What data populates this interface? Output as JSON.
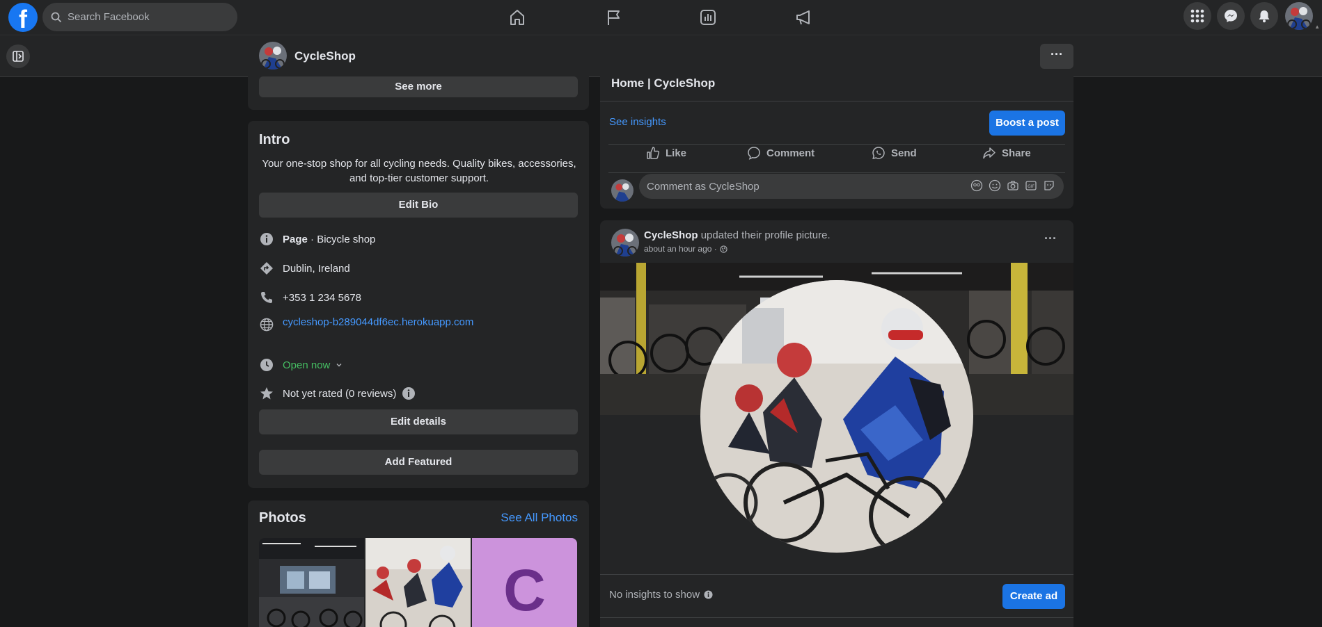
{
  "topnav": {
    "search_placeholder": "Search Facebook"
  },
  "pagebar": {
    "page_name": "CycleShop",
    "more_label": "···"
  },
  "left": {
    "see_more": "See more",
    "intro": {
      "title": "Intro",
      "bio": "Your one-stop shop for all cycling needs. Quality bikes, accessories, and top-tier customer support.",
      "edit_bio": "Edit Bio",
      "page_label": "Page",
      "page_category": " · Bicycle shop",
      "location": "Dublin, Ireland",
      "phone": "+353 1 234 5678",
      "website": "cycleshop-b289044df6ec.herokuapp.com",
      "hours": "Open now",
      "rating": "Not yet rated (0 reviews)",
      "edit_details": "Edit details",
      "add_featured": "Add Featured"
    },
    "photos": {
      "title": "Photos",
      "see_all": "See All Photos",
      "letter_tile": "C"
    }
  },
  "right": {
    "home_title": "Home | CycleShop",
    "see_insights": "See insights",
    "boost": "Boost a post",
    "actions": [
      "Like",
      "Comment",
      "Send",
      "Share"
    ],
    "comment_placeholder": "Comment as CycleShop",
    "post": {
      "author": "CycleShop",
      "text": " updated their profile picture.",
      "time": "about an hour ago ·",
      "more": "···",
      "no_insights": "No insights to show",
      "create_ad": "Create ad"
    }
  },
  "colors": {
    "background": "#18191a",
    "surface": "#242526",
    "button": "#3a3b3c",
    "accent": "#1b74e4",
    "link": "#4599ff",
    "open": "#45bd62",
    "tile": "#cc93dc",
    "tile_letter": "#6a2f8a"
  }
}
